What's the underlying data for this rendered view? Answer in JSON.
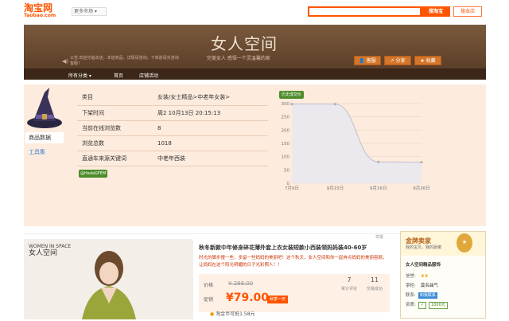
{
  "header": {
    "logo_cn": "淘宝网",
    "logo_en": "Taobao.com",
    "market_dropdown": "更多市场",
    "search_button": "搜淘宝",
    "shop_button": "搜本店",
    "brand_color": "#ff5500"
  },
  "banner": {
    "title": "女人空间",
    "subtitle": "完美女人 感悟一个灵温馨的家",
    "notice": "公告:欢迎光临本店，本店商品，详情请咨询，下单前请先咨询客服！",
    "buttons": [
      "客服",
      "分享",
      "收藏"
    ]
  },
  "nav": {
    "items": [
      "所有分类",
      "首页",
      "店铺活动"
    ]
  },
  "sidebar": {
    "tabs": [
      "商品数据",
      "工具集"
    ],
    "active_tab": "商品数据",
    "bottom_badge": "@HadaGFEM"
  },
  "info_table": {
    "rows": [
      {
        "key": "类目",
        "value": "女装/女士精品>中老年女装>"
      },
      {
        "key": "下架时间",
        "value": "周2 10月13日 20:15:13"
      },
      {
        "key": "当前在线浏览数",
        "value": "8"
      },
      {
        "key": "浏览总数",
        "value": "1018"
      },
      {
        "key": "直通车来源关键词",
        "value": "中老年西装"
      }
    ]
  },
  "chart_data": {
    "type": "area",
    "title": "历史成交价",
    "x": [
      "7月9日",
      "9月15日",
      "9月16日",
      "9月26日"
    ],
    "y_ticks": [
      0,
      50,
      100,
      150,
      200,
      250,
      300
    ],
    "values": [
      298,
      298,
      80,
      79
    ],
    "ylim": [
      0,
      300
    ],
    "grid": true
  },
  "product": {
    "image_brand_en": "WOMEN IN SPACE",
    "image_brand_cn": "女人空间",
    "title": "秋冬新款中年修身碎花薄外套上衣女装短款小西装领妈妈装40-60岁",
    "description": "时光的脚步慢一些，多留一些妈妈的美丽吧！这个秋天，女人空间和你一起奔点妈妈的美丽容颜，让妈妈在这个阳光明媚的日子光彩照人！！",
    "price_label": "价格",
    "original_price": "298.00",
    "promo_label": "促销",
    "promo_price": "¥79.00",
    "promo_tag": "秋季一天",
    "reviews_count": "7",
    "reviews_label": "累计评论",
    "sales_count": "11",
    "sales_label": "交易成功",
    "shipping": "淘金币可抵1.58元",
    "report": "举报"
  },
  "seller": {
    "title": "金牌卖家",
    "subtitle": "我的宝贝，我的骄傲",
    "shop_name": "女人空间精品服饰",
    "rows": [
      {
        "label": "信誉:",
        "value": ""
      },
      {
        "label": "掌柜:",
        "value": "莫名曲气"
      },
      {
        "label": "联系:",
        "value": "和我联系"
      },
      {
        "label": "资质:",
        "value": "1000元"
      }
    ]
  }
}
